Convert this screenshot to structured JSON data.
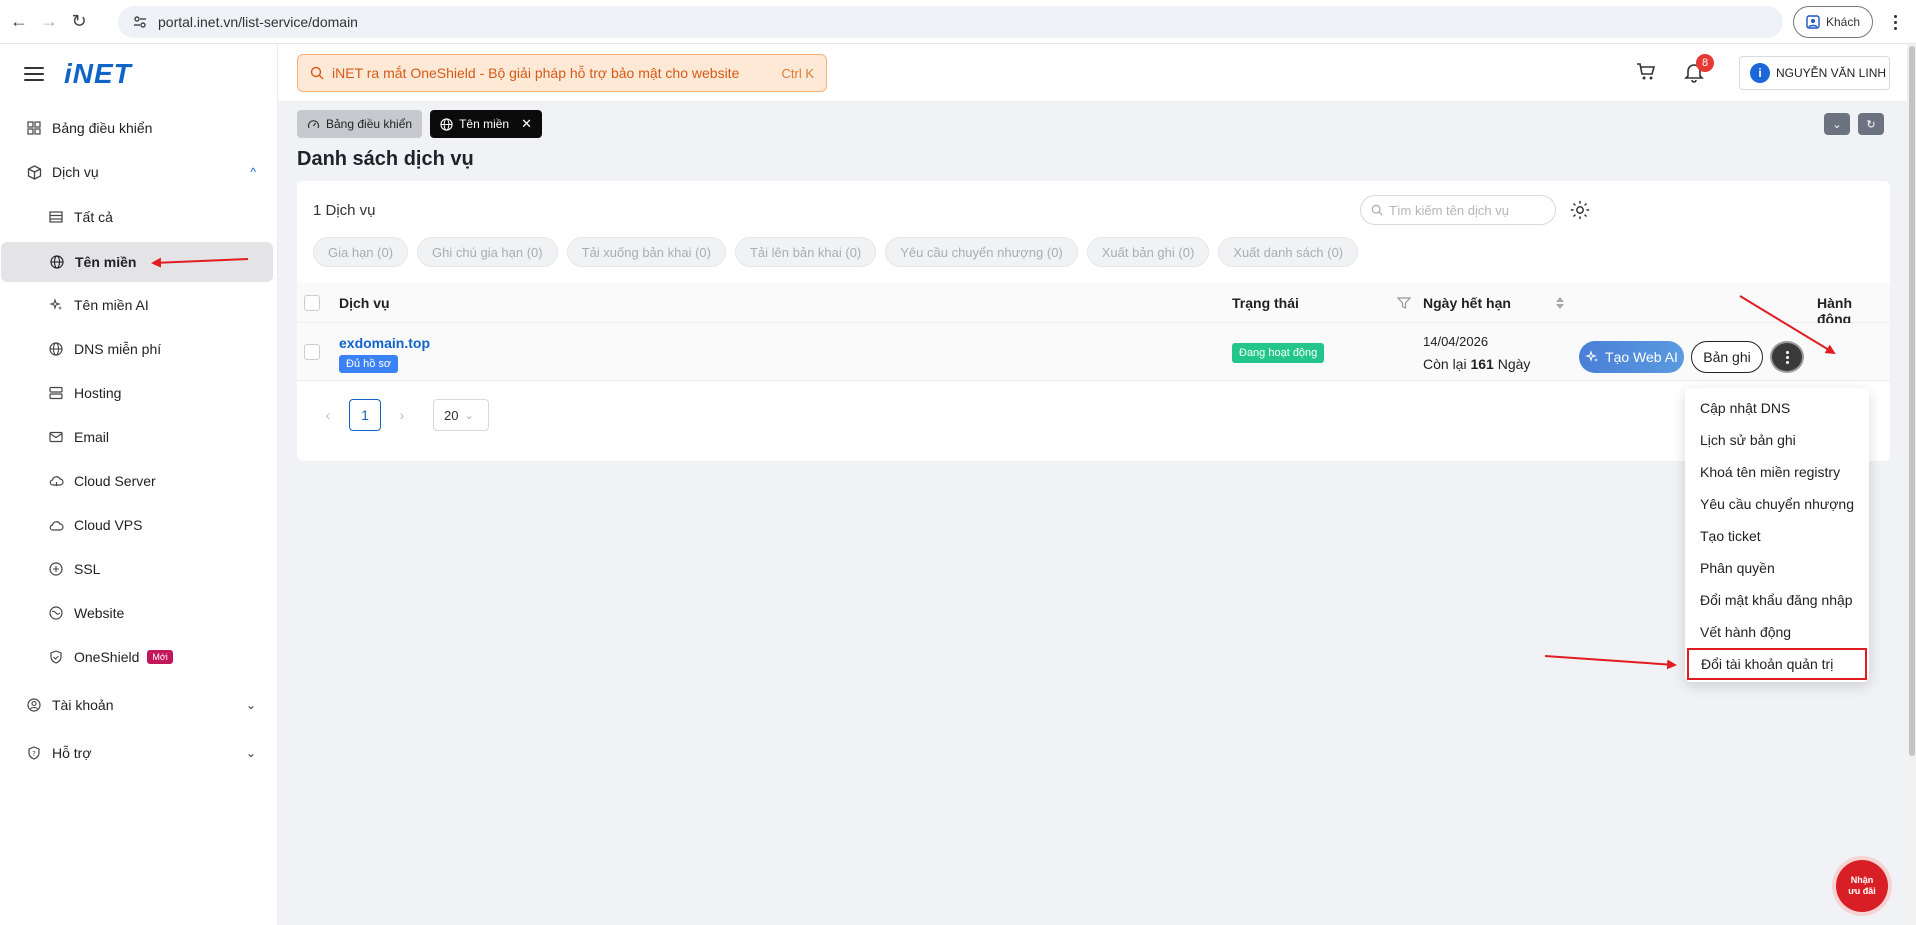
{
  "browser": {
    "url": "portal.inet.vn/list-service/domain",
    "guest_label": "Khách"
  },
  "brand": {
    "logo": "iNET"
  },
  "sidebar": {
    "items": [
      {
        "label": "Bảng điều khiển",
        "icon": "dashboard-icon"
      },
      {
        "label": "Dịch vụ",
        "icon": "box-icon"
      },
      {
        "label": "Tất cả",
        "icon": "list-icon"
      },
      {
        "label": "Tên miền",
        "icon": "globe-icon"
      },
      {
        "label": "Tên miền AI",
        "icon": "sparkle-icon"
      },
      {
        "label": "DNS miễn phí",
        "icon": "globe-icon"
      },
      {
        "label": "Hosting",
        "icon": "server-icon"
      },
      {
        "label": "Email",
        "icon": "mail-icon"
      },
      {
        "label": "Cloud Server",
        "icon": "cloud-icon"
      },
      {
        "label": "Cloud VPS",
        "icon": "cloud-icon"
      },
      {
        "label": "SSL",
        "icon": "ssl-icon"
      },
      {
        "label": "Website",
        "icon": "website-icon"
      },
      {
        "label": "OneShield",
        "icon": "shield-icon",
        "badge": "Mới"
      },
      {
        "label": "Tài khoản",
        "icon": "user-icon"
      },
      {
        "label": "Hỗ trợ",
        "icon": "support-icon"
      }
    ]
  },
  "header": {
    "promo_text": "iNET ra mắt OneShield - Bộ giải pháp hỗ trợ bảo mật cho website",
    "promo_shortcut": "Ctrl K",
    "notification_count": "8",
    "user_name": "NGUYỄN VĂN LINH",
    "user_initial": "i"
  },
  "tabs": [
    {
      "label": "Bảng điều khiển"
    },
    {
      "label": "Tên miền"
    }
  ],
  "page": {
    "title": "Danh sách dịch vụ",
    "count_label": "1 Dịch vụ",
    "search_placeholder": "Tìm kiếm tên dịch vụ"
  },
  "actions": [
    "Gia hạn (0)",
    "Ghi chú gia hạn (0)",
    "Tải xuống bản khai (0)",
    "Tải lên bản khai (0)",
    "Yêu cầu chuyển nhượng (0)",
    "Xuất bản ghi (0)",
    "Xuất danh sách (0)"
  ],
  "table": {
    "columns": {
      "service": "Dịch vụ",
      "status": "Trạng thái",
      "expiry": "Ngày hết hạn",
      "action": "Hành động"
    },
    "rows": [
      {
        "domain": "exdomain.top",
        "doc_badge": "Đủ hồ sơ",
        "status": "Đang hoạt động",
        "expiry_date": "14/04/2026",
        "remain_prefix": "Còn lại",
        "remain_days": "161",
        "remain_suffix": "Ngày",
        "webai_label": "Tạo Web AI",
        "record_label": "Bản ghi"
      }
    ]
  },
  "pagination": {
    "current": "1",
    "page_size": "20"
  },
  "dropdown": {
    "items": [
      "Cập nhật DNS",
      "Lịch sử bản ghi",
      "Khoá tên miền registry",
      "Yêu cầu chuyển nhượng",
      "Tạo ticket",
      "Phân quyền",
      "Đổi mật khẩu đăng nhập",
      "Vết hành động",
      "Đổi tài khoản quản trị"
    ]
  },
  "floating_promo": {
    "line1": "Nhận",
    "line2": "ưu đãi"
  },
  "colors": {
    "brand": "#1064c8",
    "status_active": "#22c58b",
    "highlight": "#e11d23"
  }
}
